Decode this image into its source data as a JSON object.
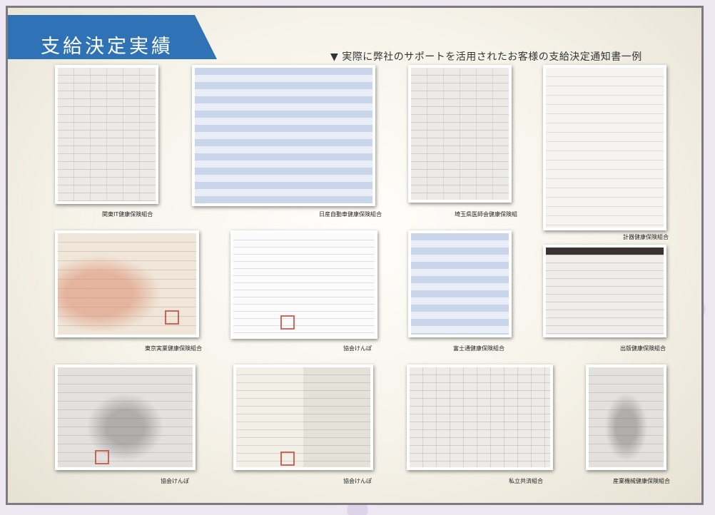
{
  "header": {
    "title": "支給決定実績",
    "subtitle": "▼ 実際に弊社のサポートを活用されたお客様の支給決定通知書一例"
  },
  "documents": [
    {
      "caption": "関東IT健康保険組合"
    },
    {
      "caption": "日産自動車健康保険組合"
    },
    {
      "caption": "埼玉県医師会健康保険組"
    },
    {
      "caption": "計器健康保険組合"
    },
    {
      "caption": "東京実業健康保険組合"
    },
    {
      "caption": "協会けんぽ"
    },
    {
      "caption": "富士通健康保険組合"
    },
    {
      "caption": "出版健康保険組合"
    },
    {
      "caption": "協会けんぽ"
    },
    {
      "caption": "協会けんぽ"
    },
    {
      "caption": "私立共済組合"
    },
    {
      "caption": "産業機械健康保険組合"
    }
  ],
  "colors": {
    "banner": "#2f73b6",
    "frame_border": "#7d7a80"
  }
}
